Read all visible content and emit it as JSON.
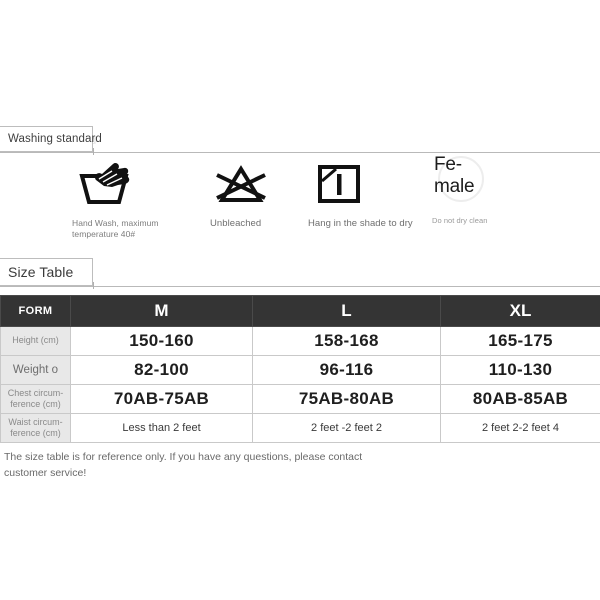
{
  "sections": {
    "washing": {
      "tab_label": "Washing standard",
      "ghost_label": "Washing standard"
    },
    "size": {
      "tab_label": "Size Table",
      "ghost_label": "Size Table"
    }
  },
  "washing_symbols": [
    {
      "icon": "hand-wash-icon",
      "caption": "Hand Wash, maximum temperature 40#"
    },
    {
      "icon": "do-not-bleach-icon",
      "caption": "Unbleached"
    },
    {
      "icon": "hang-in-shade-to-dry-icon",
      "caption": "Hang in the shade to dry"
    },
    {
      "icon": "do-not-dry-clean-icon",
      "overlay_text_line1": "Fe-",
      "overlay_text_line2": "male",
      "caption": "Do not dry clean"
    }
  ],
  "size_table": {
    "headers": [
      "FORM",
      "M",
      "L",
      "XL"
    ],
    "rows": [
      {
        "label": "Height (cm)",
        "label_style": "small",
        "value_style": "big",
        "values": [
          "150-160",
          "158-168",
          "165-175"
        ]
      },
      {
        "label": "Weight o",
        "label_style": "large",
        "value_style": "big",
        "values": [
          "82-100",
          "96-116",
          "110-130"
        ]
      },
      {
        "label": "Chest circum-ference (cm)",
        "label_line1": "Chest circum-",
        "label_line2": "ference (cm)",
        "label_style": "small",
        "value_style": "big",
        "values": [
          "70AB-75AB",
          "75AB-80AB",
          "80AB-85AB"
        ]
      },
      {
        "label": "Waist circum-ference (cm)",
        "label_line1": "Waist circum-",
        "label_line2": "ference (cm)",
        "label_style": "small",
        "value_style": "small",
        "values": [
          "Less than 2 feet",
          "2 feet -2 feet 2",
          "2 feet 2-2 feet 4"
        ]
      }
    ]
  },
  "footnote": "The size table is for reference only. If you have any questions, please contact customer service!",
  "colors": {
    "header_bg": "#343434",
    "header_text": "#ffffff",
    "label_bg": "#e8e8e8",
    "label_text": "#8a8a8a",
    "value_text": "#1f1f1f",
    "rule": "#b9b9b9",
    "tab_border": "#bdbdbd",
    "footnote_text": "#6a6a6a"
  }
}
